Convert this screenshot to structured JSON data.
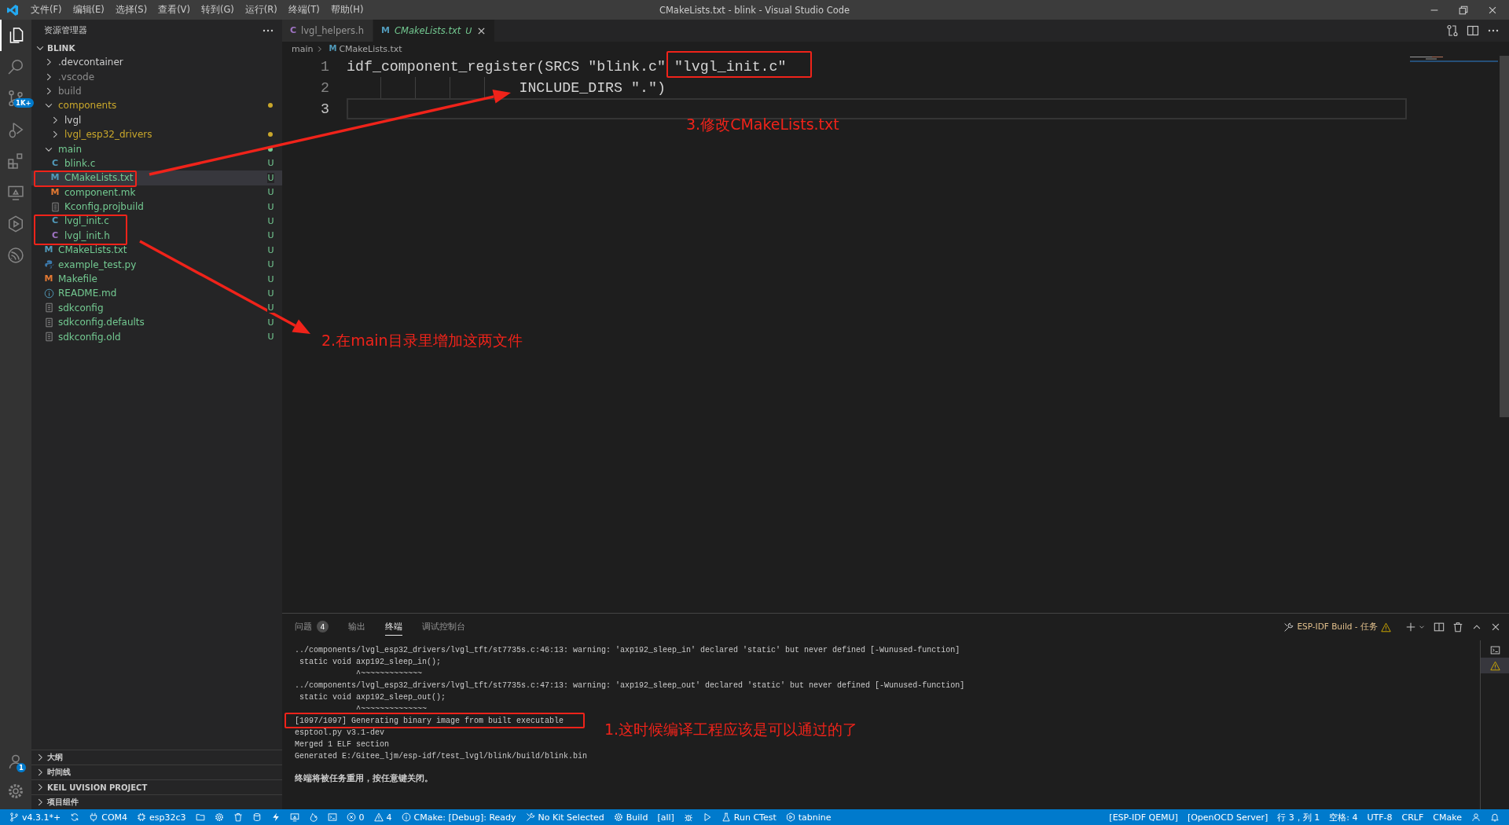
{
  "title_bar": {
    "menus": [
      "文件(F)",
      "编辑(E)",
      "选择(S)",
      "查看(V)",
      "转到(G)",
      "运行(R)",
      "终端(T)",
      "帮助(H)"
    ],
    "title": "CMakeLists.txt - blink - Visual Studio Code"
  },
  "activity_bar": {
    "items": [
      {
        "kind": "files",
        "selected": true
      },
      {
        "kind": "search",
        "selected": false
      },
      {
        "kind": "scm",
        "selected": false,
        "badge": "1K+"
      },
      {
        "kind": "debug",
        "selected": false
      },
      {
        "kind": "extensions",
        "selected": false
      },
      {
        "kind": "remote",
        "selected": false
      },
      {
        "kind": "hexplay",
        "selected": false
      },
      {
        "kind": "esp",
        "selected": false
      }
    ],
    "bottom": [
      {
        "kind": "account",
        "badge": "1"
      },
      {
        "kind": "settings"
      }
    ]
  },
  "sidebar": {
    "title": "资源管理器",
    "root": {
      "label": "BLINK",
      "expanded": true,
      "children": [
        {
          "label": ".devcontainer",
          "kind": "folder",
          "expanded": false,
          "color": "#cccccc",
          "dot": false,
          "selected": false
        },
        {
          "label": ".vscode",
          "kind": "folder",
          "expanded": false,
          "color": "#8c8c8c",
          "dot": false,
          "selected": false
        },
        {
          "label": "build",
          "kind": "folder",
          "expanded": false,
          "color": "#8c8c8c",
          "dot": false,
          "selected": false
        },
        {
          "label": "components",
          "kind": "folder",
          "expanded": true,
          "color": "#c9a72b",
          "dot": true,
          "selected": false,
          "children": [
            {
              "label": "lvgl",
              "kind": "folder",
              "expanded": false,
              "color": "#cccccc",
              "dot": false,
              "selected": false
            },
            {
              "label": "lvgl_esp32_drivers",
              "kind": "folder",
              "expanded": false,
              "color": "#c9a72b",
              "dot": true,
              "selected": false
            }
          ]
        },
        {
          "label": "main",
          "kind": "folder",
          "expanded": true,
          "color": "#73c991",
          "dot": true,
          "selected": false,
          "children": [
            {
              "label": "blink.c",
              "kind": "c",
              "glyph": "C",
              "color": "#73c991",
              "decoration": "U",
              "selected": false
            },
            {
              "label": "CMakeLists.txt",
              "kind": "cmake",
              "glyph": "M",
              "color": "#73c991",
              "decoration": "U",
              "selected": true
            },
            {
              "label": "component.mk",
              "kind": "make",
              "glyph": "M",
              "color": "#73c991",
              "decoration": "U",
              "selected": false
            },
            {
              "label": "Kconfig.projbuild",
              "kind": "config",
              "color": "#73c991",
              "decoration": "U",
              "selected": false
            },
            {
              "label": "lvgl_init.c",
              "kind": "c",
              "glyph": "C",
              "color": "#73c991",
              "decoration": "U",
              "selected": false
            },
            {
              "label": "lvgl_init.h",
              "kind": "h",
              "glyph": "C",
              "color": "#73c991",
              "decoration": "U",
              "selected": false
            }
          ]
        },
        {
          "label": "CMakeLists.txt",
          "kind": "cmake",
          "glyph": "M",
          "color": "#73c991",
          "decoration": "U",
          "selected": false
        },
        {
          "label": "example_test.py",
          "kind": "python",
          "color": "#73c991",
          "decoration": "U",
          "selected": false
        },
        {
          "label": "Makefile",
          "kind": "make",
          "glyph": "M",
          "color": "#73c991",
          "decoration": "U",
          "selected": false
        },
        {
          "label": "README.md",
          "kind": "info",
          "color": "#73c991",
          "decoration": "U",
          "selected": false
        },
        {
          "label": "sdkconfig",
          "kind": "config",
          "color": "#73c991",
          "decoration": "U",
          "selected": false
        },
        {
          "label": "sdkconfig.defaults",
          "kind": "config",
          "color": "#73c991",
          "decoration": "U",
          "selected": false
        },
        {
          "label": "sdkconfig.old",
          "kind": "config",
          "color": "#73c991",
          "decoration": "U",
          "selected": false
        }
      ]
    },
    "sections": [
      {
        "label": "大纲",
        "expanded": false
      },
      {
        "label": "时间线",
        "expanded": false
      },
      {
        "label": "KEIL UVISION PROJECT",
        "expanded": false
      },
      {
        "label": "项目组件",
        "expanded": false
      }
    ]
  },
  "editor": {
    "tabs": [
      {
        "label": "lvgl_helpers.h",
        "kind": "h",
        "glyph": "C",
        "selected": false,
        "preview": false
      },
      {
        "label": "CMakeLists.txt",
        "kind": "cmake",
        "glyph": "M",
        "selected": true,
        "preview": true,
        "decoration": "U"
      }
    ],
    "breadcrumb": [
      {
        "label": "main"
      },
      {
        "label": "CMakeLists.txt",
        "kind": "cmake",
        "glyph": "M"
      }
    ],
    "lines": [
      {
        "number": "1",
        "current": false,
        "segments": [
          "idf_component_register(SRCS \"blink.c\" ",
          "\"lvgl_init.c\""
        ]
      },
      {
        "number": "2",
        "current": false,
        "segments": [
          "                    INCLUDE_DIRS \".\")"
        ]
      },
      {
        "number": "3",
        "current": true
      }
    ]
  },
  "panel": {
    "tabs": [
      {
        "label": "问题",
        "count": "4",
        "selected": false
      },
      {
        "label": "输出",
        "selected": false
      },
      {
        "label": "终端",
        "selected": true
      },
      {
        "label": "调试控制台",
        "selected": false
      }
    ],
    "task": {
      "label": "ESP-IDF Build - 任务",
      "warning": true
    },
    "terminal_lines": [
      {
        "kind": "normal",
        "text": "../components/lvgl_esp32_drivers/lvgl_tft/st7735s.c:46:13: warning: 'axp192_sleep_in' declared 'static' but never defined [-Wunused-function]"
      },
      {
        "kind": "normal",
        "text": " static void axp192_sleep_in();"
      },
      {
        "kind": "normal",
        "text": "             ^~~~~~~~~~~~~~"
      },
      {
        "kind": "normal",
        "text": "../components/lvgl_esp32_drivers/lvgl_tft/st7735s.c:47:13: warning: 'axp192_sleep_out' declared 'static' but never defined [-Wunused-function]"
      },
      {
        "kind": "normal",
        "text": " static void axp192_sleep_out();"
      },
      {
        "kind": "normal",
        "text": "             ^~~~~~~~~~~~~~~"
      },
      {
        "kind": "normal",
        "text": "[1097/1097] Generating binary image from built executable"
      },
      {
        "kind": "normal",
        "text": "esptool.py v3.1-dev"
      },
      {
        "kind": "normal",
        "text": "Merged 1 ELF section"
      },
      {
        "kind": "normal",
        "text": "Generated E:/Gitee_ljm/esp-idf/test_lvgl/blink/build/blink.bin"
      },
      {
        "kind": "notice",
        "text": "终端将被任务重用，按任意键关闭。"
      }
    ],
    "terminals": [
      {
        "kind": "terminal",
        "selected": false
      },
      {
        "kind": "warning",
        "selected": true
      }
    ]
  },
  "status_bar": {
    "left": [
      {
        "kind": "branch",
        "text": "v4.3.1*+"
      },
      {
        "kind": "sync"
      },
      {
        "kind": "plug",
        "text": "COM4"
      },
      {
        "kind": "chip",
        "text": "esp32c3"
      },
      {
        "kind": "folder"
      },
      {
        "kind": "gear"
      },
      {
        "kind": "trash"
      },
      {
        "kind": "database"
      },
      {
        "kind": "bolt"
      },
      {
        "kind": "monitor"
      },
      {
        "kind": "flame"
      },
      {
        "kind": "terminal"
      },
      {
        "kind": "error",
        "text": "0"
      },
      {
        "kind": "warning",
        "text": "4"
      },
      {
        "kind": "info",
        "text": "CMake: [Debug]: Ready"
      },
      {
        "kind": "tools",
        "text": "No Kit Selected"
      },
      {
        "kind": "gear",
        "text": "Build"
      },
      {
        "kind": "plain",
        "text": "[all]"
      },
      {
        "kind": "bug"
      },
      {
        "kind": "play"
      },
      {
        "kind": "beaker",
        "text": "Run CTest"
      },
      {
        "kind": "tabnine",
        "text": "tabnine"
      }
    ],
    "right": [
      {
        "kind": "plain",
        "text": "[ESP-IDF QEMU]"
      },
      {
        "kind": "plain",
        "text": "[OpenOCD Server]"
      },
      {
        "kind": "plain",
        "text": "行 3，列 1"
      },
      {
        "kind": "plain",
        "text": "空格: 4"
      },
      {
        "kind": "plain",
        "text": "UTF-8"
      },
      {
        "kind": "plain",
        "text": "CRLF"
      },
      {
        "kind": "plain",
        "text": "CMake"
      },
      {
        "kind": "feedback"
      },
      {
        "kind": "bell"
      }
    ]
  },
  "annotations": [
    {
      "text": "3.修改CMakeLists.txt"
    },
    {
      "text": "2.在main目录里增加这两文件"
    },
    {
      "text": "1.这时候编译工程应该是可以通过的了"
    }
  ]
}
